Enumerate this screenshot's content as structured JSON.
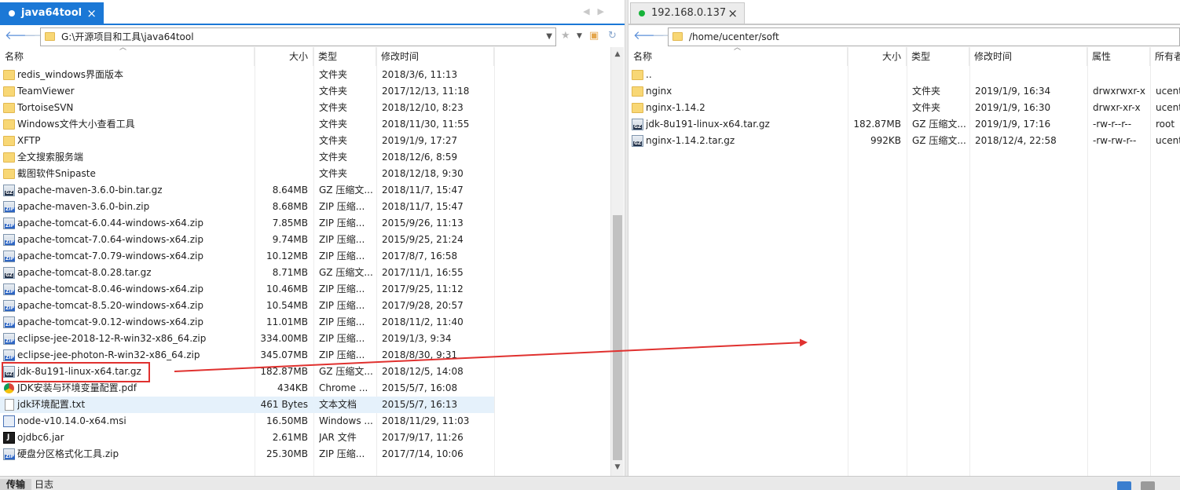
{
  "left": {
    "tab_title": "java64tool",
    "path": "G:\\开源项目和工具\\java64tool",
    "columns": {
      "name": "名称",
      "size": "大小",
      "type": "类型",
      "mtime": "修改时间"
    },
    "files": [
      {
        "icon": "folder",
        "name": "redis_windows界面版本",
        "size": "",
        "type": "文件夹",
        "mtime": "2018/3/6, 11:13"
      },
      {
        "icon": "folder",
        "name": "TeamViewer",
        "size": "",
        "type": "文件夹",
        "mtime": "2017/12/13, 11:18"
      },
      {
        "icon": "folder",
        "name": "TortoiseSVN",
        "size": "",
        "type": "文件夹",
        "mtime": "2018/12/10, 8:23"
      },
      {
        "icon": "folder",
        "name": "Windows文件大小查看工具",
        "size": "",
        "type": "文件夹",
        "mtime": "2018/11/30, 11:55"
      },
      {
        "icon": "folder",
        "name": "XFTP",
        "size": "",
        "type": "文件夹",
        "mtime": "2019/1/9, 17:27"
      },
      {
        "icon": "folder",
        "name": "全文搜索服务端",
        "size": "",
        "type": "文件夹",
        "mtime": "2018/12/6, 8:59"
      },
      {
        "icon": "folder",
        "name": "截图软件Snipaste",
        "size": "",
        "type": "文件夹",
        "mtime": "2018/12/18, 9:30"
      },
      {
        "icon": "gz",
        "name": "apache-maven-3.6.0-bin.tar.gz",
        "size": "8.64MB",
        "type": "GZ 压缩文...",
        "mtime": "2018/11/7, 15:47"
      },
      {
        "icon": "zip",
        "name": "apache-maven-3.6.0-bin.zip",
        "size": "8.68MB",
        "type": "ZIP 压缩...",
        "mtime": "2018/11/7, 15:47"
      },
      {
        "icon": "zip",
        "name": "apache-tomcat-6.0.44-windows-x64.zip",
        "size": "7.85MB",
        "type": "ZIP 压缩...",
        "mtime": "2015/9/26, 11:13"
      },
      {
        "icon": "zip",
        "name": "apache-tomcat-7.0.64-windows-x64.zip",
        "size": "9.74MB",
        "type": "ZIP 压缩...",
        "mtime": "2015/9/25, 21:24"
      },
      {
        "icon": "zip",
        "name": "apache-tomcat-7.0.79-windows-x64.zip",
        "size": "10.12MB",
        "type": "ZIP 压缩...",
        "mtime": "2017/8/7, 16:58"
      },
      {
        "icon": "gz",
        "name": "apache-tomcat-8.0.28.tar.gz",
        "size": "8.71MB",
        "type": "GZ 压缩文...",
        "mtime": "2017/11/1, 16:55"
      },
      {
        "icon": "zip",
        "name": "apache-tomcat-8.0.46-windows-x64.zip",
        "size": "10.46MB",
        "type": "ZIP 压缩...",
        "mtime": "2017/9/25, 11:12"
      },
      {
        "icon": "zip",
        "name": "apache-tomcat-8.5.20-windows-x64.zip",
        "size": "10.54MB",
        "type": "ZIP 压缩...",
        "mtime": "2017/9/28, 20:57"
      },
      {
        "icon": "zip",
        "name": "apache-tomcat-9.0.12-windows-x64.zip",
        "size": "11.01MB",
        "type": "ZIP 压缩...",
        "mtime": "2018/11/2, 11:40"
      },
      {
        "icon": "zip",
        "name": "eclipse-jee-2018-12-R-win32-x86_64.zip",
        "size": "334.00MB",
        "type": "ZIP 压缩...",
        "mtime": "2019/1/3, 9:34"
      },
      {
        "icon": "zip",
        "name": "eclipse-jee-photon-R-win32-x86_64.zip",
        "size": "345.07MB",
        "type": "ZIP 压缩...",
        "mtime": "2018/8/30, 9:31"
      },
      {
        "icon": "gz",
        "name": "jdk-8u191-linux-x64.tar.gz",
        "size": "182.87MB",
        "type": "GZ 压缩文...",
        "mtime": "2018/12/5, 14:08"
      },
      {
        "icon": "pdf",
        "name": "JDK安装与环境变量配置.pdf",
        "size": "434KB",
        "type": "Chrome ...",
        "mtime": "2015/5/7, 16:08"
      },
      {
        "icon": "txt",
        "name": "jdk环境配置.txt",
        "size": "461 Bytes",
        "type": "文本文档",
        "mtime": "2015/5/7, 16:13"
      },
      {
        "icon": "msi",
        "name": "node-v10.14.0-x64.msi",
        "size": "16.50MB",
        "type": "Windows ...",
        "mtime": "2018/11/29, 11:03"
      },
      {
        "icon": "jar",
        "name": "ojdbc6.jar",
        "size": "2.61MB",
        "type": "JAR 文件",
        "mtime": "2017/9/17, 11:26"
      },
      {
        "icon": "zip",
        "name": "硬盘分区格式化工具.zip",
        "size": "25.30MB",
        "type": "ZIP 压缩...",
        "mtime": "2017/7/14, 10:06"
      }
    ]
  },
  "right": {
    "tab_title": "192.168.0.137",
    "path": "/home/ucenter/soft",
    "columns": {
      "name": "名称",
      "size": "大小",
      "type": "类型",
      "mtime": "修改时间",
      "attr": "属性",
      "owner": "所有者"
    },
    "files": [
      {
        "icon": "folder",
        "name": "..",
        "size": "",
        "type": "",
        "mtime": "",
        "attr": "",
        "owner": ""
      },
      {
        "icon": "folder",
        "name": "nginx",
        "size": "",
        "type": "文件夹",
        "mtime": "2019/1/9, 16:34",
        "attr": "drwxrwxr-x",
        "owner": "ucenter"
      },
      {
        "icon": "folder",
        "name": "nginx-1.14.2",
        "size": "",
        "type": "文件夹",
        "mtime": "2019/1/9, 16:30",
        "attr": "drwxr-xr-x",
        "owner": "ucenter"
      },
      {
        "icon": "gz",
        "name": "jdk-8u191-linux-x64.tar.gz",
        "size": "182.87MB",
        "type": "GZ 压缩文...",
        "mtime": "2019/1/9, 17:16",
        "attr": "-rw-r--r--",
        "owner": "root"
      },
      {
        "icon": "gz",
        "name": "nginx-1.14.2.tar.gz",
        "size": "992KB",
        "type": "GZ 压缩文...",
        "mtime": "2018/12/4, 22:58",
        "attr": "-rw-rw-r--",
        "owner": "ucenter"
      }
    ]
  },
  "statusbar": {
    "transfer_tab": "传输",
    "log_tab": "日志"
  },
  "colors": {
    "accent": "#1b78d6",
    "connected": "#17b33a",
    "annotation": "#e0312f"
  }
}
